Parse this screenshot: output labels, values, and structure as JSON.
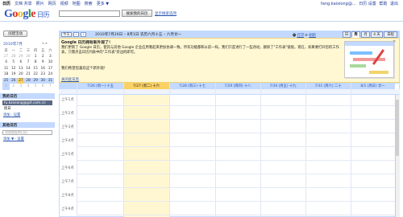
{
  "topnav": {
    "items": [
      "日历",
      "文档 共享",
      "照片",
      "网页",
      "视频",
      "地图",
      "搜索",
      "更多 ▼"
    ],
    "right_email": "fang.kaixiong@...",
    "right_links": [
      "日历 设置",
      "帮助",
      "退出"
    ]
  },
  "header": {
    "logo_google": "Google",
    "logo_calendar": "日历",
    "search_placeholder": "",
    "search_button": "搜索我的日历",
    "search_options": "显示搜索选项"
  },
  "sidebar": {
    "create_button": "创建活动",
    "mini_title": "2010年7月",
    "mini_nav": "« »",
    "weekday_headers": [
      "日",
      "一",
      "二",
      "三",
      "四",
      "五",
      "六"
    ],
    "weeks": [
      [
        "27",
        "28",
        "29",
        "30",
        "1",
        "2",
        "3"
      ],
      [
        "4",
        "5",
        "6",
        "7",
        "8",
        "9",
        "10"
      ],
      [
        "11",
        "12",
        "13",
        "14",
        "15",
        "16",
        "17"
      ],
      [
        "18",
        "19",
        "20",
        "21",
        "22",
        "23",
        "24"
      ],
      [
        "25",
        "26",
        "27",
        "28",
        "29",
        "30",
        "31"
      ],
      [
        "1",
        "2",
        "3",
        "4",
        "5",
        "6",
        "7"
      ]
    ],
    "my_calendars_title": "我的日历",
    "my_calendars": [
      "fu.kaixiong@gst.com.cn",
      "假日"
    ],
    "my_links": "添加 · 设置",
    "other_calendars_title": "其他日历",
    "add_friend_placeholder": "添加朋友的日历",
    "other_links": "添加 ▼ · 设置"
  },
  "toolbar": {
    "today": "今天",
    "prev": "‹",
    "next": "›",
    "range": "2010年7月26日 – 8月1日 农历六月十五 – 六月廿一",
    "print": "打印",
    "refresh": "刷新",
    "views": [
      "日",
      "周",
      "月",
      "4 天",
      "日程"
    ],
    "active_view": "周"
  },
  "notice": {
    "title": "Google 日历拥有新外观了！",
    "close_x": "×",
    "body": "我们更新了 Google 日历，使其与其他 Google 企业应用看起来更加协调一致。所有功能都和以前一样。我们只是进行了一些改动，删除了\"工作表\"链接。现在，如果要打开您的工作表，只需点击日历列表中的\"工作表\"旁边的即可。",
    "question": "我们希望您喜欢这个新外观！",
    "close_link": "关闭此讯息"
  },
  "week": {
    "days": [
      "7/26 (周一) 十五",
      "7/27 (周二) 十六",
      "7/28 (周三) 十七",
      "7/29 (周四) 十八",
      "7/30 (周五) 十九",
      "7/31 (周六) 二十",
      "8/1 (周日) 廿一"
    ],
    "times": [
      "上午1点",
      "上午2点",
      "上午3点",
      "上午4点",
      "上午5点",
      "上午6点",
      "上午7点",
      "上午8点",
      "上午9点"
    ]
  },
  "colors": {
    "accent": "#c3d9ff",
    "today": "#fad163",
    "notice_bg": "#fff8d2"
  }
}
